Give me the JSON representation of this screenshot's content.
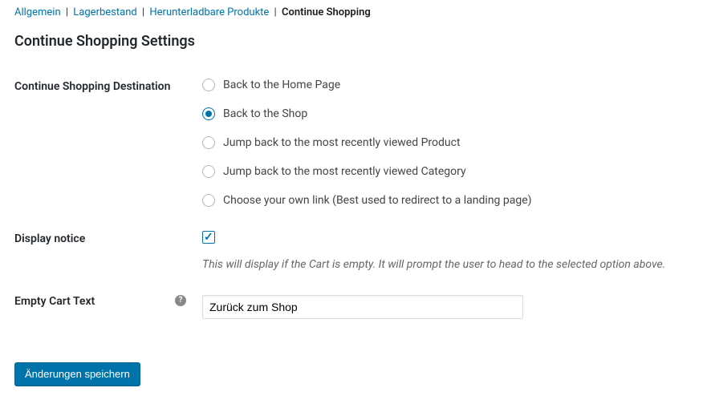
{
  "tabs": {
    "general": "Allgemein",
    "inventory": "Lagerbestand",
    "downloadable": "Herunterladbare Produkte",
    "continue": "Continue Shopping"
  },
  "heading": "Continue Shopping Settings",
  "destination": {
    "label": "Continue Shopping Destination",
    "options": [
      "Back to the Home Page",
      "Back to the Shop",
      "Jump back to the most recently viewed Product",
      "Jump back to the most recently viewed Category",
      "Choose your own link (Best used to redirect to a landing page)"
    ],
    "selected": 1
  },
  "displayNotice": {
    "label": "Display notice",
    "checked": true,
    "description": "This will display if the Cart is empty. It will prompt the user to head to the selected option above."
  },
  "emptyCartText": {
    "label": "Empty Cart Text",
    "value": "Zurück zum Shop"
  },
  "saveButton": "Änderungen speichern"
}
